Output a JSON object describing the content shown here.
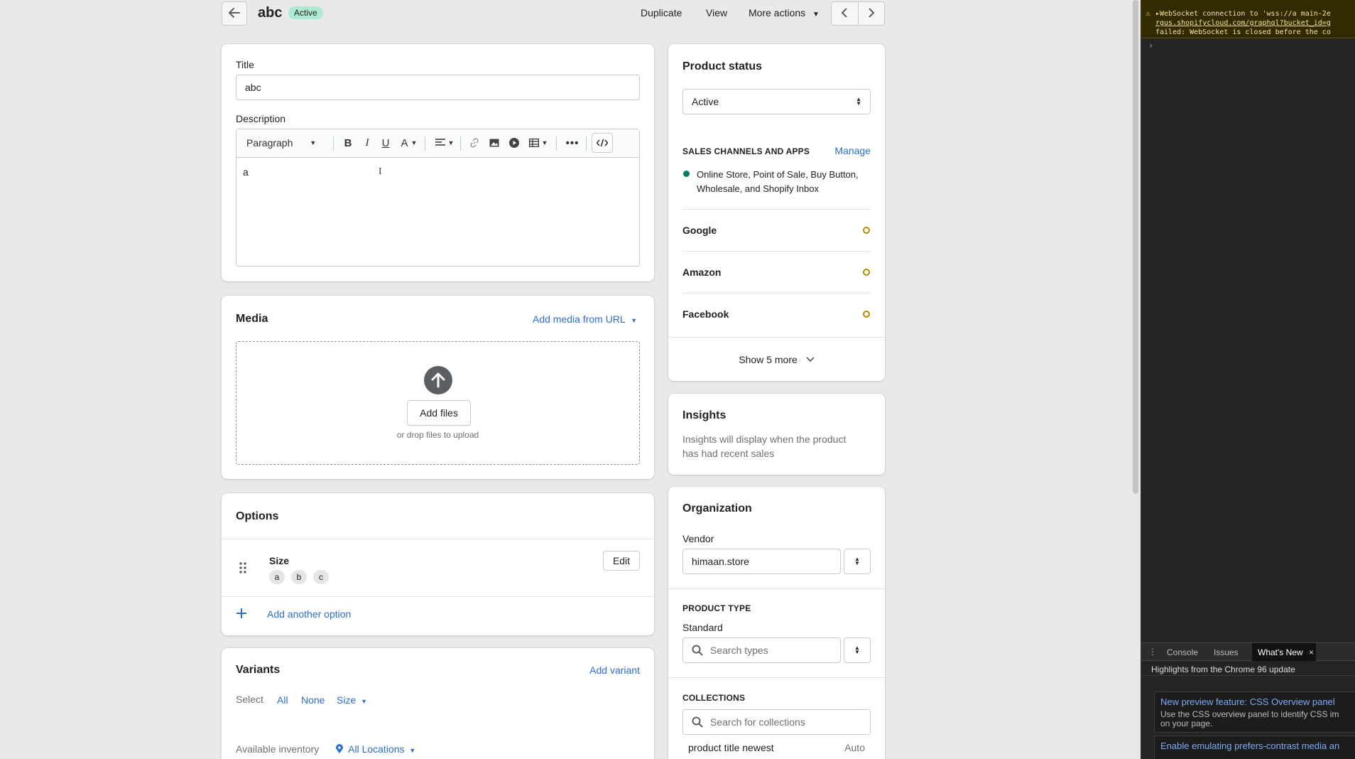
{
  "header": {
    "back_label": "←",
    "title": "abc",
    "status": "Active",
    "actions": [
      "Duplicate",
      "View",
      "More actions"
    ],
    "prev": "‹",
    "next": "›"
  },
  "main": {
    "title_label": "Title",
    "title_value": "abc",
    "description_label": "Description",
    "editor": {
      "paragraph": "Paragraph",
      "content": "a"
    },
    "media": {
      "heading": "Media",
      "add_from_url": "Add media from URL",
      "add_files": "Add files",
      "drop_hint": "or drop files to upload"
    },
    "options": {
      "heading": "Options",
      "option_name": "Size",
      "values": [
        "a",
        "b",
        "c"
      ],
      "edit": "Edit",
      "add_another": "Add another option"
    },
    "variants": {
      "heading": "Variants",
      "add_variant": "Add variant",
      "select_label": "Select",
      "all": "All",
      "none": "None",
      "size": "Size",
      "available_inventory": "Available inventory",
      "all_locations": "All Locations"
    }
  },
  "sidebar": {
    "status_heading": "Product status",
    "status_value": "Active",
    "channels_heading": "SALES CHANNELS AND APPS",
    "manage": "Manage",
    "channels_line1": "Online Store, Point of Sale, Buy Button,",
    "channels_line2": "Wholesale, and Shopify Inbox",
    "channels": [
      "Google",
      "Amazon",
      "Facebook"
    ],
    "show_more": "Show 5 more",
    "insights_heading": "Insights",
    "insights_line1": "Insights will display when the product",
    "insights_line2": "has had recent sales",
    "organization_heading": "Organization",
    "vendor_label": "Vendor",
    "vendor_value": "himaan.store",
    "product_type_heading": "PRODUCT TYPE",
    "product_type_value": "Standard",
    "search_types_placeholder": "Search types",
    "collections_heading": "COLLECTIONS",
    "search_collections_placeholder": "Search for collections",
    "collection_item": "product title newest",
    "collection_type": "Auto"
  },
  "devtools": {
    "console_line1": "▸WebSocket connection to 'wss://a main-2e",
    "console_line2": "rgus.shopifycloud.com/graphql?bucket_id=g",
    "console_line3": "failed: WebSocket is closed before the co",
    "prompt": "›",
    "tabs": [
      "Console",
      "Issues",
      "What's New"
    ],
    "close": "×",
    "highlights": "Highlights from the Chrome 96 update",
    "item1_title": "New preview feature: CSS Overview panel",
    "item1_line1": "Use the CSS overview panel to identify CSS im",
    "item1_line2": "on your page.",
    "item2_title": "Enable emulating prefers-contrast media an"
  },
  "colors": {
    "accent": "#2c6ecb",
    "status_badge": "#aee9d1",
    "channel_active": "#008060",
    "channel_pending": "#b98900"
  }
}
